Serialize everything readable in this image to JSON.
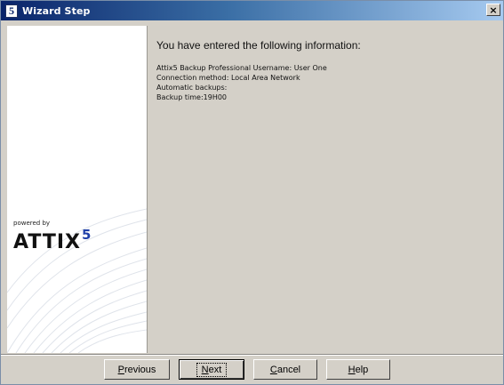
{
  "window": {
    "title": "Wizard Step",
    "icon_glyph": "5",
    "close_glyph": "×"
  },
  "sidepanel": {
    "powered_by": "powered by",
    "brand": "ATTIX",
    "brand_superscript": "5",
    "brand_accent_color": "#1f3fa8"
  },
  "content": {
    "heading": "You have entered the following information:",
    "lines": [
      "Attix5 Backup Professional Username: User One",
      "Connection method: Local Area Network",
      "Automatic backups:",
      "Backup time:19H00"
    ]
  },
  "buttons": {
    "previous": {
      "mnemonic": "P",
      "rest": "revious"
    },
    "next": {
      "mnemonic": "N",
      "rest": "ext"
    },
    "cancel": {
      "mnemonic": "C",
      "rest": "ancel"
    },
    "help": {
      "mnemonic": "H",
      "rest": "elp"
    }
  },
  "colors": {
    "titlebar_start": "#0a246a",
    "titlebar_end": "#a6caf0",
    "dialog_bg": "#d4d0c8"
  }
}
